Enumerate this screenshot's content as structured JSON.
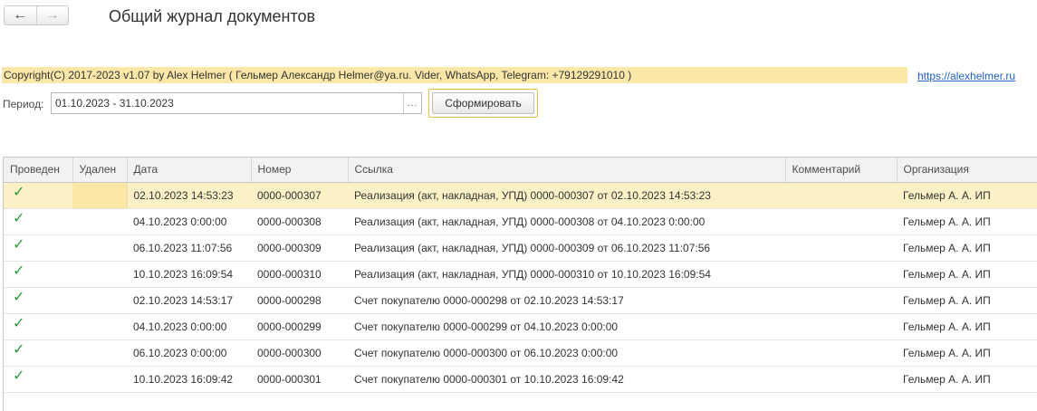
{
  "nav": {
    "back_icon": "arrow-left-icon",
    "forward_icon": "arrow-right-icon"
  },
  "title": "Общий журнал документов",
  "copyright": "Copyright(C)  2017-2023 v1.07 by Alex Helmer ( Гельмер Александр Helmer@ya.ru. Vider, WhatsApp, Telegram: +79129291010 )",
  "site_link": "https://alexhelmer.ru",
  "period": {
    "label": "Период:",
    "value": "01.10.2023 - 31.10.2023",
    "choose_label": "..."
  },
  "form_button": "Сформировать",
  "colors": {
    "accent": "#fbe8a9",
    "selected_row": "#fbf0c6",
    "check": "#2e9a3e",
    "link": "#1f5fbf"
  },
  "table": {
    "columns": [
      "Проведен",
      "Удален",
      "Дата",
      "Номер",
      "Ссылка",
      "Комментарий",
      "Организация"
    ],
    "rows": [
      {
        "posted": "✓",
        "deleted": "",
        "date": "02.10.2023 14:53:23",
        "number": "0000-000307",
        "link": "Реализация (акт, накладная, УПД) 0000-000307 от 02.10.2023 14:53:23",
        "comment": "",
        "org": "Гельмер А. А. ИП"
      },
      {
        "posted": "✓",
        "deleted": "",
        "date": "04.10.2023 0:00:00",
        "number": "0000-000308",
        "link": "Реализация (акт, накладная, УПД) 0000-000308 от 04.10.2023 0:00:00",
        "comment": "",
        "org": "Гельмер А. А. ИП"
      },
      {
        "posted": "✓",
        "deleted": "",
        "date": "06.10.2023 11:07:56",
        "number": "0000-000309",
        "link": "Реализация (акт, накладная, УПД) 0000-000309 от 06.10.2023 11:07:56",
        "comment": "",
        "org": "Гельмер А. А. ИП"
      },
      {
        "posted": "✓",
        "deleted": "",
        "date": "10.10.2023 16:09:54",
        "number": "0000-000310",
        "link": "Реализация (акт, накладная, УПД) 0000-000310 от 10.10.2023 16:09:54",
        "comment": "",
        "org": "Гельмер А. А. ИП"
      },
      {
        "posted": "✓",
        "deleted": "",
        "date": "02.10.2023 14:53:17",
        "number": "0000-000298",
        "link": "Счет покупателю 0000-000298 от 02.10.2023 14:53:17",
        "comment": "",
        "org": "Гельмер А. А. ИП"
      },
      {
        "posted": "✓",
        "deleted": "",
        "date": "04.10.2023 0:00:00",
        "number": "0000-000299",
        "link": "Счет покупателю 0000-000299 от 04.10.2023 0:00:00",
        "comment": "",
        "org": "Гельмер А. А. ИП"
      },
      {
        "posted": "✓",
        "deleted": "",
        "date": "06.10.2023 0:00:00",
        "number": "0000-000300",
        "link": "Счет покупателю 0000-000300 от 06.10.2023 0:00:00",
        "comment": "",
        "org": "Гельмер А. А. ИП"
      },
      {
        "posted": "✓",
        "deleted": "",
        "date": "10.10.2023 16:09:42",
        "number": "0000-000301",
        "link": "Счет покупателю 0000-000301 от 10.10.2023 16:09:42",
        "comment": "",
        "org": "Гельмер А. А. ИП"
      }
    ]
  }
}
